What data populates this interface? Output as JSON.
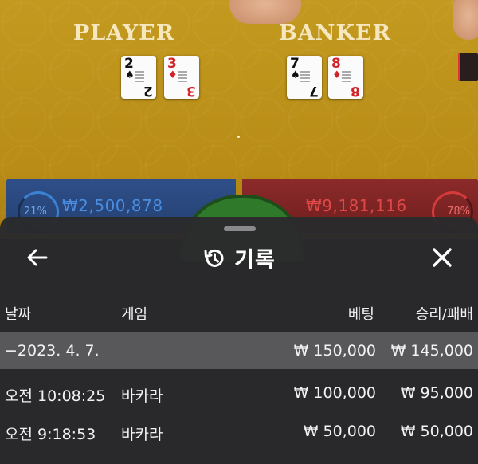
{
  "table": {
    "player_label": "PLAYER",
    "banker_label": "BANKER",
    "player_cards": [
      {
        "rank": "2",
        "suit": "♠",
        "color": "black"
      },
      {
        "rank": "3",
        "suit": "♦",
        "color": "red"
      }
    ],
    "banker_cards": [
      {
        "rank": "7",
        "suit": "♠",
        "color": "black"
      },
      {
        "rank": "8",
        "suit": "♦",
        "color": "red"
      }
    ],
    "player_bet": "₩2,500,878",
    "player_pct": "21%",
    "banker_bet": "₩9,181,116",
    "banker_pct": "78%"
  },
  "sheet": {
    "title": "기록",
    "back_icon": "arrow-left-icon",
    "history_icon": "history-icon",
    "close_icon": "close-icon",
    "columns": {
      "date": "날짜",
      "game": "게임",
      "bet": "베팅",
      "result": "승리/패배"
    },
    "summary": {
      "date": "−2023. 4. 7.",
      "bet": "₩ 150,000",
      "result": "₩ 145,000"
    },
    "entries": [
      {
        "time": "오전 10:08:25",
        "game": "바카라",
        "bet": "₩ 100,000",
        "result": "₩ 95,000"
      },
      {
        "time": "오전 9:18:53",
        "game": "바카라",
        "bet": "₩ 50,000",
        "result": "₩ 50,000"
      }
    ]
  },
  "colors": {
    "felt": "#b88c16",
    "player_panel": "#2f4f8a",
    "banker_panel": "#8c2a2a",
    "sheet_bg": "#2a2a2c",
    "summary_row": "#58585a"
  }
}
